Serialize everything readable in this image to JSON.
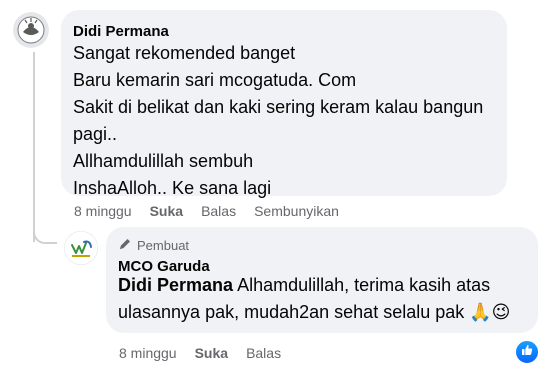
{
  "comment": {
    "author": "Didi Permana",
    "lines": [
      "Sangat rekomended banget",
      "Baru kemarin sari mcogatuda. Com",
      "Sakit di belikat dan kaki sering keram kalau bangun",
      "pagi..",
      "Allhamdulillah sembuh",
      "InshaAlloh.. Ke sana lagi"
    ],
    "time": "8 minggu",
    "like_label": "Suka",
    "reply_label": "Balas",
    "hide_label": "Sembunyikan"
  },
  "reply": {
    "badge_label": "Pembuat",
    "author": "MCO Garuda",
    "mention": "Didi Permana",
    "line1_rest": "Alhamdulillah, terima kasih atas",
    "line2": "ulasannya pak, mudah2an sehat selalu pak 🙏😉",
    "time": "8 minggu",
    "like_label": "Suka",
    "reply_label": "Balas",
    "reaction_icon": "thumbs-up-icon"
  },
  "colors": {
    "bubble": "#f0f2f5",
    "meta_text": "#65676b",
    "like_blue": "#0866ff"
  }
}
